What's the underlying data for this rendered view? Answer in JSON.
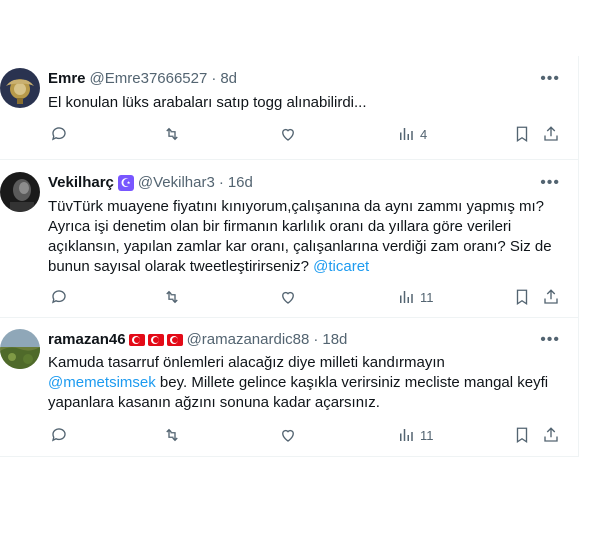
{
  "tweets": [
    {
      "name": "Emre",
      "handle": "@Emre37666527",
      "age": "8d",
      "text": "El konulan lüks arabaları satıp togg alınabilirdi...",
      "views": "4",
      "avatar": "emblem-avatar"
    },
    {
      "name": "Vekilharç",
      "badge": "☪",
      "handle": "@Vekilhar3",
      "age": "16d",
      "text_before": "TüvTürk muayene fiyatını kınıyorum,çalışanına da aynı zammı yapmış mı? Ayrıca işi denetim olan bir firmanın karlılık oranı da yıllara göre verileri açıklansın,  yapılan zamlar kar oranı, çalışanlarına verdiği zam oranı? Siz de bunun sayısal olarak tweetleştirirseniz? ",
      "mention": "@ticaret",
      "views": "11",
      "avatar": "dark-face-avatar"
    },
    {
      "name": "ramazan46",
      "flags": [
        "tr",
        "tr",
        "tr"
      ],
      "handle": "@ramazanardic88",
      "age": "18d",
      "text_line1": "Kamuda tasarruf önlemleri alacağız diye milleti kandırmayın",
      "mention": "@memetsimsek",
      "text_after": "  bey. Millete gelince kaşıkla verirsiniz mecliste mangal keyfi yapanlara kasanın ağzını sonuna kadar açarsınız.",
      "views": "11",
      "avatar": "landscape-avatar"
    }
  ],
  "colors": {
    "accent": "#1d9bf0",
    "muted": "#536471",
    "text": "#0f1419",
    "border": "#eff3f4",
    "flag": "#e30a17",
    "badge": "#7856ff"
  },
  "icons": [
    "reply-icon",
    "repost-icon",
    "like-icon",
    "views-icon",
    "bookmark-icon",
    "share-icon",
    "more-icon"
  ]
}
